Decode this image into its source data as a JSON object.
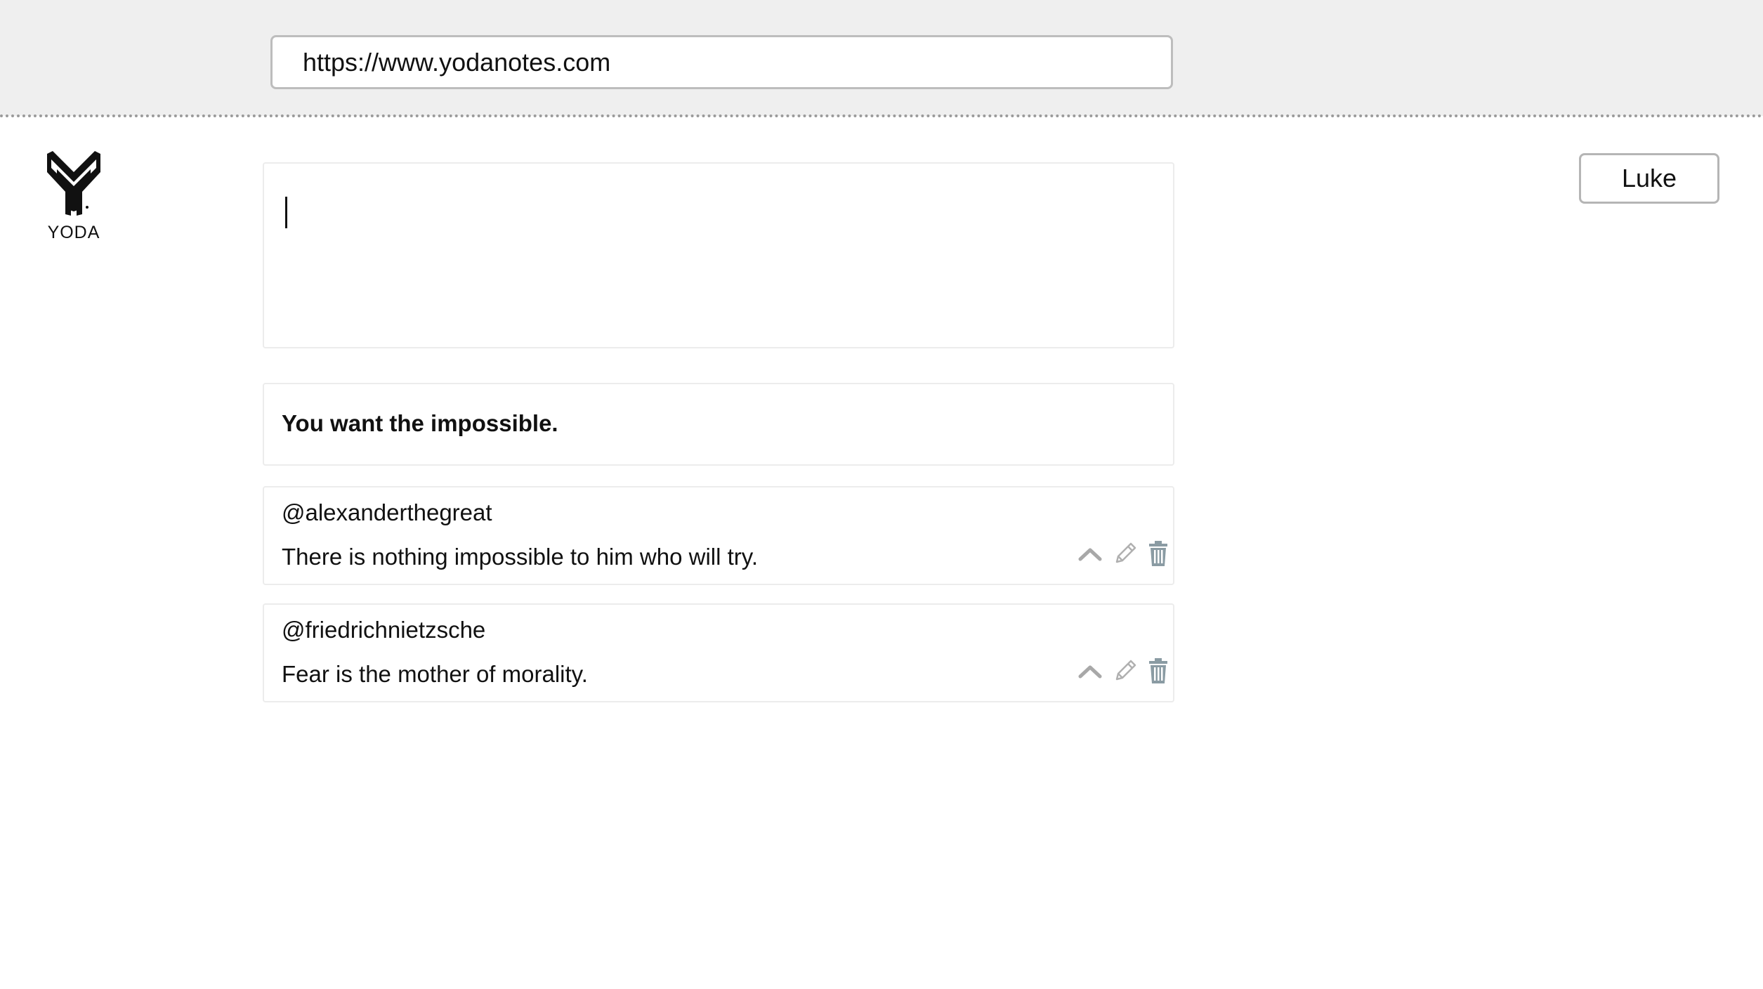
{
  "browser": {
    "url": "https://www.yodanotes.com"
  },
  "logo": {
    "text": "YODA",
    "icon": "yoda-logo-icon"
  },
  "user": {
    "name": "Luke"
  },
  "editor": {
    "value": ""
  },
  "prompt": {
    "text": "You want the impossible."
  },
  "replies": [
    {
      "author": "@alexanderthegreat",
      "text": "There is nothing impossible to him who will try.",
      "actions": [
        "chevron-up-icon",
        "pencil-icon",
        "trash-icon"
      ]
    },
    {
      "author": "@friedrichnietzsche",
      "text": "Fear is the mother of morality.",
      "actions": [
        "chevron-up-icon",
        "pencil-icon",
        "trash-icon"
      ]
    }
  ],
  "colors": {
    "browser_bar": "#efefef",
    "icon_gray": "#a8a8a8",
    "trash_gray": "#8a9ba3"
  }
}
